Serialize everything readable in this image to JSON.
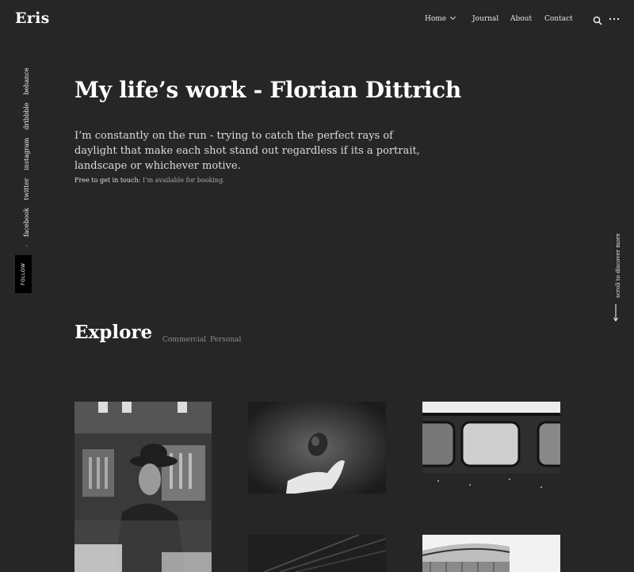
{
  "brand": {
    "logo": "Eris"
  },
  "nav": {
    "items": [
      {
        "label": "Home",
        "has_dropdown": true
      },
      {
        "label": "Journal"
      },
      {
        "label": "About"
      },
      {
        "label": "Contact"
      }
    ],
    "icons": [
      "search-icon",
      "more-dots-icon"
    ]
  },
  "hero": {
    "title": "My life’s work - Florian Dittrich",
    "text": "I’m constantly on the run - trying to catch the perfect rays of daylight that make each shot stand out regardless if its a portrait, landscape or whichever motive.",
    "contact_label": "Free to get in touch:",
    "contact_link": "I’m available for booking."
  },
  "social": {
    "follow_label": "FOLLOW",
    "separator": "-",
    "links": [
      "facebook",
      "twitter",
      "instagram",
      "dribbble",
      "behance"
    ]
  },
  "scroll_hint": "scroll to discover more",
  "explore": {
    "title": "Explore",
    "filters": [
      "Commercial",
      "Personal"
    ]
  },
  "gallery": [
    {
      "subject": "woman with hat, double exposure"
    },
    {
      "subject": "hand with floating stone"
    },
    {
      "subject": "train windows"
    },
    {
      "subject": "dark angled lines"
    },
    {
      "subject": "white architecture"
    }
  ],
  "colors": {
    "background": "#262626",
    "text": "#ffffff",
    "muted": "#8c8c8c",
    "follow_bg": "#000000"
  }
}
